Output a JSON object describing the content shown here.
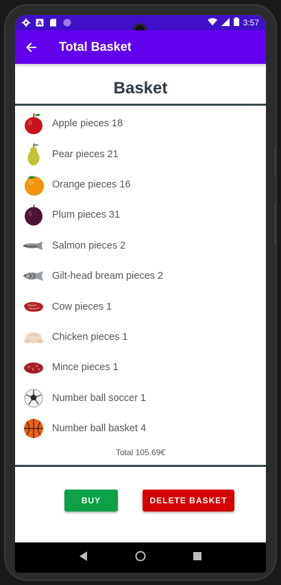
{
  "status_bar": {
    "time": "3:57",
    "left_icons": [
      "gear-icon",
      "a-icon",
      "sd-card-icon",
      "circle-icon"
    ],
    "right_icons": [
      "wifi-icon",
      "signal-icon",
      "battery-icon"
    ]
  },
  "app_bar": {
    "title": "Total Basket",
    "back_icon": "arrow-left-icon"
  },
  "heading": "Basket",
  "items": [
    {
      "label": "Apple pieces 18",
      "icon": "apple-icon"
    },
    {
      "label": "Pear pieces 21",
      "icon": "pear-icon"
    },
    {
      "label": "Orange pieces 16",
      "icon": "orange-icon"
    },
    {
      "label": "Plum pieces 31",
      "icon": "plum-icon"
    },
    {
      "label": "Salmon pieces 2",
      "icon": "salmon-icon"
    },
    {
      "label": "Gilt-head bream pieces 2",
      "icon": "bream-icon"
    },
    {
      "label": "Cow pieces 1",
      "icon": "beef-icon"
    },
    {
      "label": "Chicken pieces 1",
      "icon": "chicken-icon"
    },
    {
      "label": "Mince pieces 1",
      "icon": "mince-icon"
    },
    {
      "label": "Number ball soccer 1",
      "icon": "soccer-ball-icon"
    },
    {
      "label": "Number ball basket 4",
      "icon": "basketball-icon"
    }
  ],
  "total": "Total 105.69€",
  "buttons": {
    "buy": "BUY",
    "delete": "DELETE BASKET"
  },
  "colors": {
    "status_bar": "#3f10c8",
    "app_bar": "#6200ee",
    "buy": "#0fa04a",
    "delete": "#d50000",
    "rule": "#37474f"
  }
}
